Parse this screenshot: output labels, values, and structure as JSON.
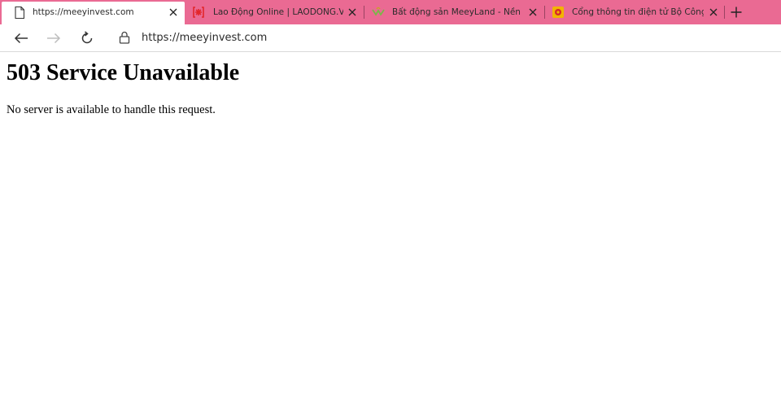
{
  "browser": {
    "tabs": [
      {
        "title": "https://meeyinvest.com",
        "favicon": "page-icon",
        "active": true
      },
      {
        "title": "Lao Động Online | LAODONG.VN",
        "favicon": "laodong-favicon-icon",
        "active": false
      },
      {
        "title": "Bất động sản MeeyLand - Nền tảng",
        "favicon": "meeyland-favicon-icon",
        "active": false
      },
      {
        "title": "Cổng thông tin điện tử Bộ Công Thương",
        "favicon": "moit-favicon-icon",
        "active": false
      }
    ],
    "address": {
      "scheme": "https://",
      "host": "meeyinvest.com"
    },
    "colors": {
      "tabbar": "#ea6a93",
      "laodong_red": "#e3262b",
      "meeyland_green": "#7ab648",
      "moit_gold": "#f2b400"
    }
  },
  "page": {
    "heading": "503 Service Unavailable",
    "message": "No server is available to handle this request."
  }
}
